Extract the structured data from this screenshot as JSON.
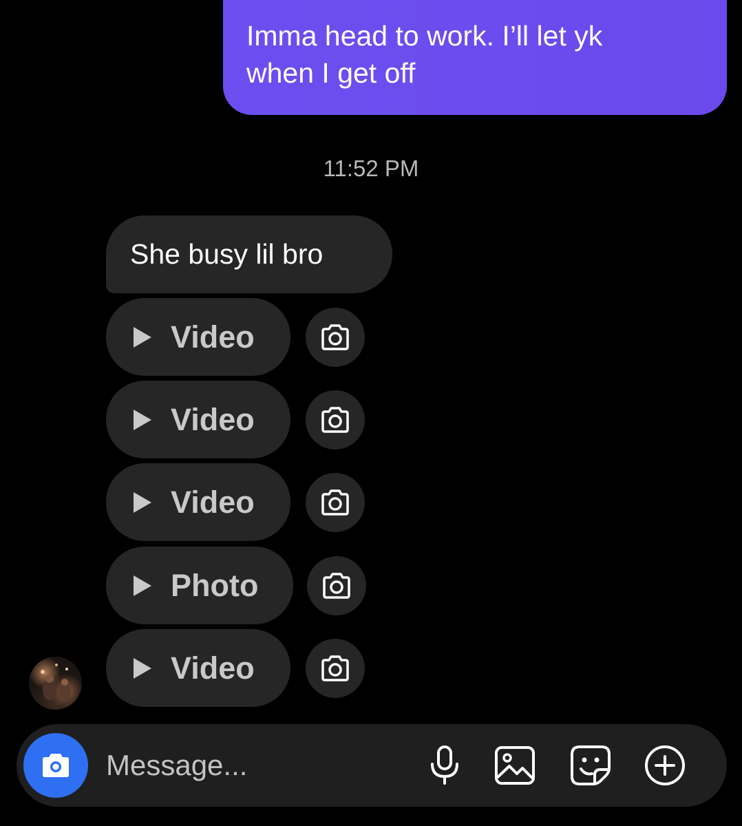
{
  "sent_message": {
    "line1": "Imma head to work. I’ll let yk",
    "line2": "when I get off"
  },
  "timestamp": "11:52 PM",
  "received_message": "She busy lil bro",
  "media_items": [
    {
      "label": "Video",
      "icon": "play-icon",
      "action_icon": "camera-icon"
    },
    {
      "label": "Video",
      "icon": "play-icon",
      "action_icon": "camera-icon"
    },
    {
      "label": "Video",
      "icon": "play-icon",
      "action_icon": "camera-icon"
    },
    {
      "label": "Photo",
      "icon": "play-icon",
      "action_icon": "camera-icon"
    },
    {
      "label": "Video",
      "icon": "play-icon",
      "action_icon": "camera-icon"
    }
  ],
  "composer": {
    "placeholder": "Message...",
    "camera_icon": "camera-icon",
    "actions": [
      "microphone-icon",
      "gallery-icon",
      "sticker-icon",
      "add-icon"
    ]
  },
  "colors": {
    "background": "#000000",
    "sent_bubble": "#6c4ff0",
    "received_bubble": "#262626",
    "composer_bg": "#1f1f1f",
    "camera_button": "#2f6ff2",
    "muted_text": "#c9c9c9"
  }
}
